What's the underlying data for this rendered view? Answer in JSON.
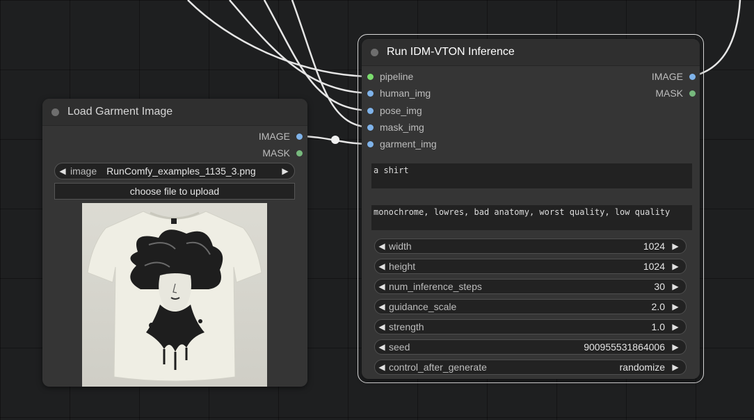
{
  "garment_node": {
    "title": "Load Garment Image",
    "outputs": [
      {
        "label": "IMAGE",
        "color": "#7fb3ea"
      },
      {
        "label": "MASK",
        "color": "#77b97d"
      }
    ],
    "image_widget": {
      "label": "image",
      "value": "RunComfy_examples_1135_3.png"
    },
    "upload_label": "choose file to upload",
    "preview_icon": "tshirt-preview-image"
  },
  "vton_node": {
    "title": "Run IDM-VTON Inference",
    "inputs": [
      {
        "label": "pipeline",
        "color": "#7bdc6e"
      },
      {
        "label": "human_img",
        "color": "#7fb3ea"
      },
      {
        "label": "pose_img",
        "color": "#7fb3ea"
      },
      {
        "label": "mask_img",
        "color": "#7fb3ea"
      },
      {
        "label": "garment_img",
        "color": "#7fb3ea"
      }
    ],
    "outputs": [
      {
        "label": "IMAGE",
        "color": "#7fb3ea"
      },
      {
        "label": "MASK",
        "color": "#77b97d"
      }
    ],
    "prompt": "a shirt",
    "negative_prompt": "monochrome, lowres, bad anatomy, worst quality, low quality",
    "widgets": [
      {
        "label": "width",
        "value": "1024"
      },
      {
        "label": "height",
        "value": "1024"
      },
      {
        "label": "num_inference_steps",
        "value": "30"
      },
      {
        "label": "guidance_scale",
        "value": "2.0"
      },
      {
        "label": "strength",
        "value": "1.0"
      },
      {
        "label": "seed",
        "value": "900955531864006"
      },
      {
        "label": "control_after_generate",
        "value": "randomize"
      }
    ]
  }
}
